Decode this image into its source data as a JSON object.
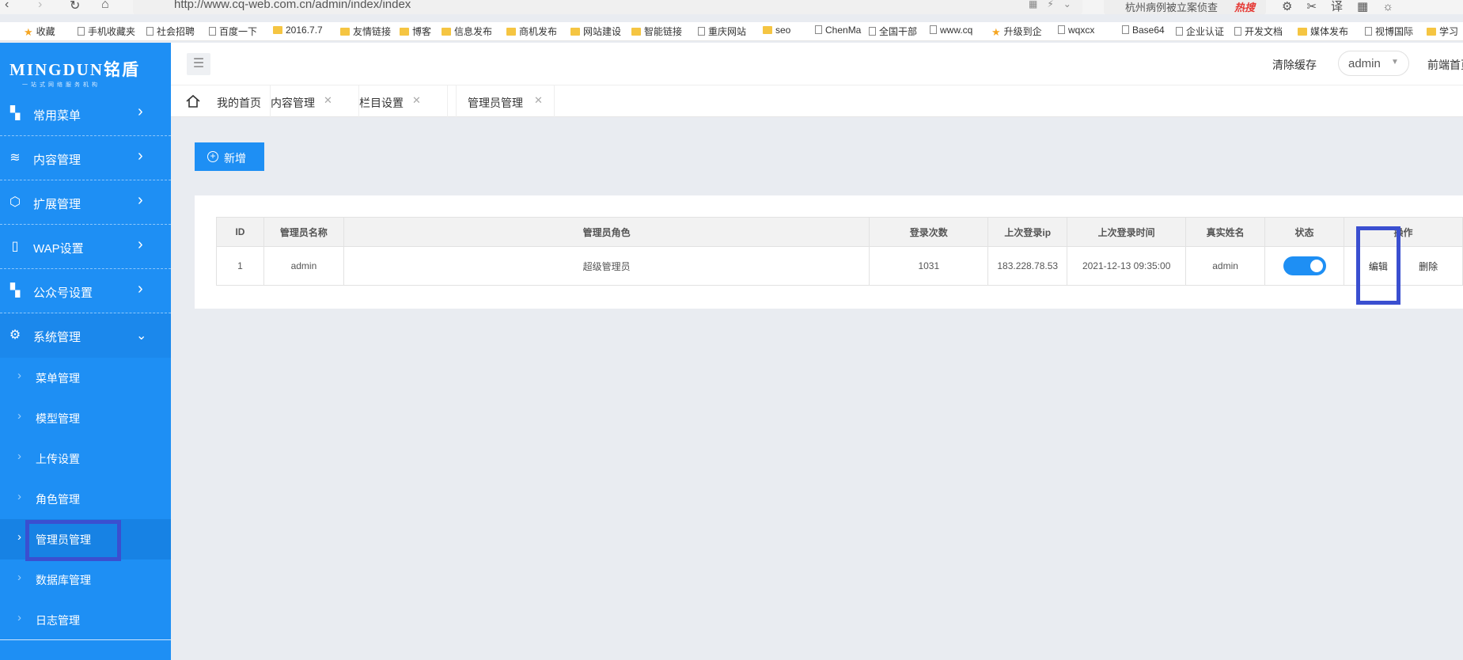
{
  "browser": {
    "url": "http://www.cq-web.com.cn/admin/index/index",
    "search_text": "杭州病例被立案侦查",
    "search_hot": "热搜"
  },
  "bookmarks": [
    {
      "label": "收藏",
      "icon": "star-icon"
    },
    {
      "label": "手机收藏夹",
      "icon": "phone-icon"
    },
    {
      "label": "社会招聘",
      "icon": "page-icon"
    },
    {
      "label": "百度一下",
      "icon": "baidu-icon"
    },
    {
      "label": "2016.7.7",
      "icon": "folder-icon"
    },
    {
      "label": "友情链接",
      "icon": "folder-icon"
    },
    {
      "label": "博客",
      "icon": "folder-icon"
    },
    {
      "label": "信息发布",
      "icon": "folder-icon"
    },
    {
      "label": "商机发布",
      "icon": "folder-icon"
    },
    {
      "label": "网站建设",
      "icon": "folder-icon"
    },
    {
      "label": "智能链接",
      "icon": "folder-icon"
    },
    {
      "label": "重庆网站",
      "icon": "page-icon"
    },
    {
      "label": "seo",
      "icon": "folder-icon"
    },
    {
      "label": "ChenMa",
      "icon": "page-icon"
    },
    {
      "label": "全国干部",
      "icon": "page-icon"
    },
    {
      "label": "www.cq",
      "icon": "globe-icon"
    },
    {
      "label": "升级到企",
      "icon": "star-icon"
    },
    {
      "label": "wqxcx",
      "icon": "page-icon"
    },
    {
      "label": "Base64",
      "icon": "page-icon"
    },
    {
      "label": "企业认证",
      "icon": "page-icon"
    },
    {
      "label": "开发文档",
      "icon": "link-icon"
    },
    {
      "label": "媒体发布",
      "icon": "folder-icon"
    },
    {
      "label": "视博国际",
      "icon": "page-icon"
    },
    {
      "label": "学习",
      "icon": "folder-icon"
    }
  ],
  "sidebar": {
    "logo": "MINGDUN铭盾",
    "logo_sub": "一站式网络服务机构",
    "menus": [
      {
        "label": "常用菜单",
        "icon": "grid-icon"
      },
      {
        "label": "内容管理",
        "icon": "layers-icon"
      },
      {
        "label": "扩展管理",
        "icon": "cube-icon"
      },
      {
        "label": "WAP设置",
        "icon": "tablet-icon"
      },
      {
        "label": "公众号设置",
        "icon": "grid-icon"
      },
      {
        "label": "系统管理",
        "icon": "gear-icon"
      }
    ],
    "submenus": [
      {
        "label": "菜单管理"
      },
      {
        "label": "模型管理"
      },
      {
        "label": "上传设置"
      },
      {
        "label": "角色管理"
      },
      {
        "label": "管理员管理"
      },
      {
        "label": "数据库管理"
      },
      {
        "label": "日志管理"
      }
    ]
  },
  "header": {
    "clear_cache": "清除缓存",
    "user": "admin",
    "front_page": "前端首页"
  },
  "tabs": [
    {
      "label": "我的首页"
    },
    {
      "label": "内容管理"
    },
    {
      "label": "栏目设置"
    },
    {
      "label": "管理员管理"
    }
  ],
  "toolbar": {
    "add_label": "新增"
  },
  "table": {
    "columns": [
      "ID",
      "管理员名称",
      "管理员角色",
      "登录次数",
      "上次登录ip",
      "上次登录时间",
      "真实姓名",
      "状态",
      "操作"
    ],
    "rows": [
      {
        "id": "1",
        "name": "admin",
        "role": "超级管理员",
        "login_count": "1031",
        "last_ip": "183.228.78.53",
        "last_time": "2021-12-13 09:35:00",
        "real_name": "admin",
        "status_on": true,
        "edit_label": "编辑",
        "delete_label": "删除"
      }
    ]
  },
  "colors": {
    "sidebar": "#1e8ff4",
    "highlight_box": "#3a4fd0",
    "accent": "#1e8ff4"
  }
}
